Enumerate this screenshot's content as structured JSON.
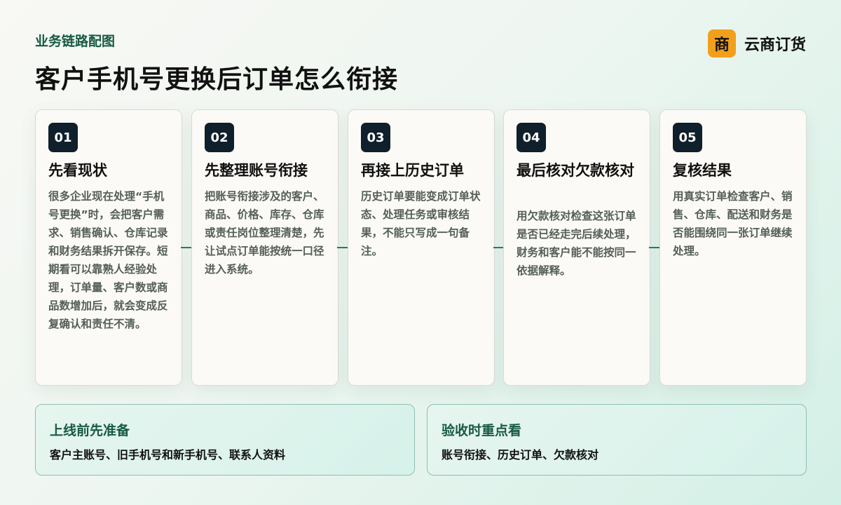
{
  "header": {
    "eyebrow": "业务链路配图",
    "title": "客户手机号更换后订单怎么衔接"
  },
  "brand": {
    "logo_char": "商",
    "name": "云商订货",
    "logo_color": "#f2a01c"
  },
  "steps": [
    {
      "number": "01",
      "title": "先看现状",
      "text": "很多企业现在处理“手机号更换”时，会把客户需求、销售确认、仓库记录和财务结果拆开保存。短期看可以靠熟人经验处理，订单量、客户数或商品数增加后，就会变成反复确认和责任不清。"
    },
    {
      "number": "02",
      "title": "先整理账号衔接",
      "text": "把账号衔接涉及的客户、商品、价格、库存、仓库或责任岗位整理清楚，先让试点订单能按统一口径进入系统。"
    },
    {
      "number": "03",
      "title": "再接上历史订单",
      "text": "历史订单要能变成订单状态、处理任务或审核结果，不能只写成一句备注。"
    },
    {
      "number": "04",
      "title": "最后核对欠款核对",
      "text": "用欠款核对检查这张订单是否已经走完后续处理，财务和客户能不能按同一依据解释。"
    },
    {
      "number": "05",
      "title": "复核结果",
      "text": "用真实订单检查客户、销售、仓库、配送和财务是否能围绕同一张订单继续处理。"
    }
  ],
  "bottom": {
    "prepare": {
      "title": "上线前先准备",
      "text": "客户主账号、旧手机号和新手机号、联系人资料"
    },
    "acceptance": {
      "title": "验收时重点看",
      "text": "账号衔接、历史订单、欠款核对"
    }
  },
  "colors": {
    "accent": "#175a45",
    "badge": "#0f1f2b",
    "connector": "#2c7a66"
  }
}
